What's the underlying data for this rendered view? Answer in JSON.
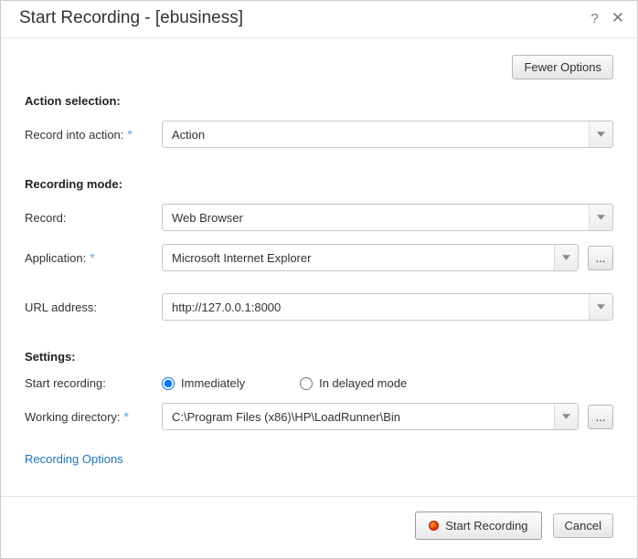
{
  "title": "Start Recording - [ebusiness]",
  "topButton": "Fewer Options",
  "sections": {
    "actionSelection": "Action selection:",
    "recordingMode": "Recording mode:",
    "settings": "Settings:"
  },
  "labels": {
    "recordIntoAction": "Record into action:",
    "record": "Record:",
    "application": "Application:",
    "urlAddress": "URL address:",
    "startRecording": "Start recording:",
    "workingDirectory": "Working directory:"
  },
  "values": {
    "action": "Action",
    "record": "Web Browser",
    "application": "Microsoft Internet Explorer",
    "url": "http://127.0.0.1:8000",
    "workingDirectory": "C:\\Program Files (x86)\\HP\\LoadRunner\\Bin"
  },
  "radios": {
    "immediately": "Immediately",
    "delayed": "In delayed mode"
  },
  "browseLabel": "...",
  "link": "Recording Options",
  "footer": {
    "start": "Start Recording",
    "cancel": "Cancel"
  }
}
